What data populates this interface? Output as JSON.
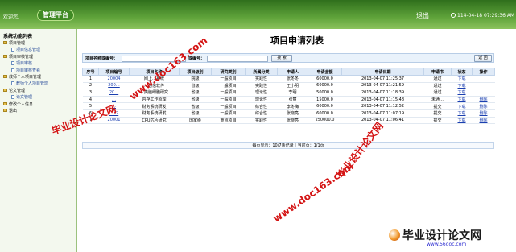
{
  "header": {
    "welcome": "欢迎您,",
    "logo_text": "管理平台",
    "exit_label": "退出",
    "datetime": "114-04-18 07:29:36 AM"
  },
  "sidebar": {
    "title": "系统功能列表",
    "items": [
      {
        "label": "项目管理",
        "type": "folder"
      },
      {
        "label": "项目信息管理",
        "type": "doc"
      },
      {
        "label": "项目审核管理",
        "type": "folder"
      },
      {
        "label": "项目审核",
        "type": "doc"
      },
      {
        "label": "项目审核查看",
        "type": "doc"
      },
      {
        "label": "教师个人项目管理",
        "type": "folder"
      },
      {
        "label": "教师个人项目管理",
        "type": "doc"
      },
      {
        "label": "论文管理",
        "type": "folder"
      },
      {
        "label": "论文管理",
        "type": "doc"
      },
      {
        "label": "修改个人信息",
        "type": "folder"
      },
      {
        "label": "退出",
        "type": "folder"
      }
    ]
  },
  "main": {
    "title": "项目申请列表",
    "search": {
      "name_label": "项目名称或编号：",
      "name_value": "",
      "code_label": "或编号：",
      "code_value": "",
      "search_button": "搜 索",
      "back_button": "返 回"
    },
    "columns": [
      "序号",
      "项目编号",
      "项目名称",
      "项目级别",
      "研究类别",
      "所属分类",
      "申请人",
      "申请金额",
      "申请日期",
      "申请书",
      "状态",
      "操作"
    ],
    "rows": [
      [
        "1",
        "20004",
        "网上…系统",
        "院级",
        "一般项目",
        "实践性",
        "张冬冬",
        "60000.0",
        "2013-04-07 11:25:37",
        "通过",
        "下载",
        ""
      ],
      [
        "2",
        "200…",
        "…通信软件",
        "省级",
        "一般项目",
        "实践性",
        "王小明",
        "60000.0",
        "2013-04-07 11:21:59",
        "通过",
        "下载",
        ""
      ],
      [
        "3",
        "20…",
        "人类脑细胞研究",
        "省级",
        "一般项目",
        "理论性",
        "李明",
        "50000.0",
        "2013-04-07 11:18:39",
        "通过",
        "下载",
        ""
      ],
      [
        "4",
        "…",
        "内存工作原理",
        "省级",
        "一般项目",
        "理论性",
        "张丽",
        "15000.0",
        "2013-04-07 11:15:48",
        "未通…",
        "下载",
        "删除"
      ],
      [
        "5",
        "…",
        "财务系统研发",
        "省级",
        "一般项目",
        "综合性",
        "李冬梅",
        "60000.0",
        "2013-04-07 11:12:52",
        "提交",
        "下载",
        "删除"
      ],
      [
        "6",
        "…02",
        "财务系统研发",
        "省级",
        "一般项目",
        "综合性",
        "张晓亮",
        "60000.0",
        "2013-04-07 11:07:19",
        "提交",
        "下载",
        "删除"
      ],
      [
        "7",
        "20001",
        "CPU芯片研究",
        "国家级",
        "重点项目",
        "实践性",
        "张晓亮",
        "250000.0",
        "2013-04-07 11:06:41",
        "提交",
        "下载",
        "删除"
      ]
    ],
    "pager": "每页显示：10/7条记录｜当前页：1/1页"
  },
  "watermarks": {
    "site_url": "www.doc163.com",
    "site_name": "毕业设计论文网",
    "footer_name": "毕业设计论文网",
    "footer_url": "www.56doc.com"
  },
  "colors": {
    "header_green": "#4f9a2e",
    "link_blue": "#1b3fb0",
    "watermark_red": "#d41414"
  }
}
